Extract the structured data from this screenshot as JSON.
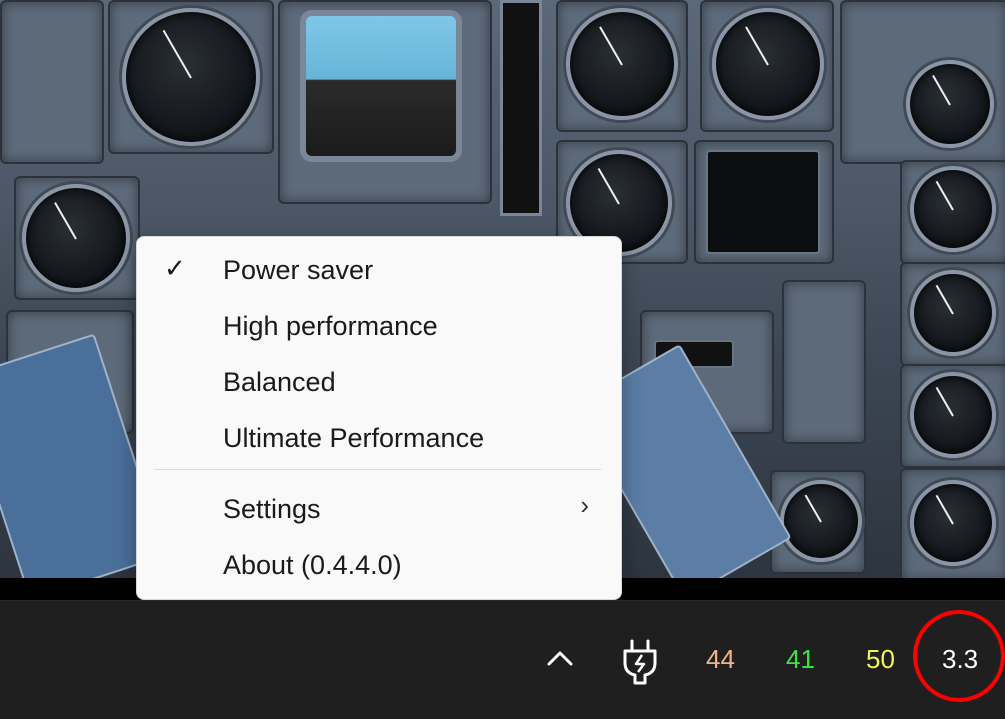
{
  "menu": {
    "items": [
      {
        "label": "Power saver",
        "checked": true
      },
      {
        "label": "High performance",
        "checked": false
      },
      {
        "label": "Balanced",
        "checked": false
      },
      {
        "label": "Ultimate Performance",
        "checked": false
      }
    ],
    "settings_label": "Settings",
    "about_label": "About (0.4.4.0)",
    "check_glyph": "✓",
    "submenu_glyph": "›"
  },
  "taskbar": {
    "show_hidden_icon": "chevron-up-icon",
    "power_icon": "power-plug-icon",
    "readouts": [
      {
        "value": "44",
        "color": "#f4b28b"
      },
      {
        "value": "41",
        "color": "#3ee43e"
      },
      {
        "value": "50",
        "color": "#f2f25a"
      },
      {
        "value": "3.3",
        "color": "#ffffff"
      }
    ],
    "highlight_color": "#ff0000"
  }
}
